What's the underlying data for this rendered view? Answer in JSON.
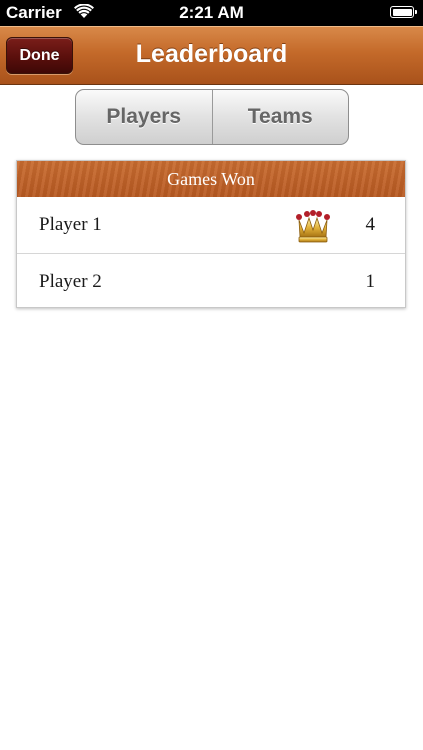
{
  "status_bar": {
    "carrier": "Carrier",
    "time": "2:21 AM"
  },
  "nav": {
    "done_label": "Done",
    "title": "Leaderboard"
  },
  "segments": [
    {
      "label": "Players"
    },
    {
      "label": "Teams"
    }
  ],
  "table": {
    "header": "Games Won",
    "rows": [
      {
        "name": "Player 1",
        "score": "4",
        "icon": "crown-icon"
      },
      {
        "name": "Player 2",
        "score": "1"
      }
    ]
  },
  "colors": {
    "navbar": "#c46a2a",
    "done_button": "#5a0f0c",
    "header": "#b85a22"
  }
}
